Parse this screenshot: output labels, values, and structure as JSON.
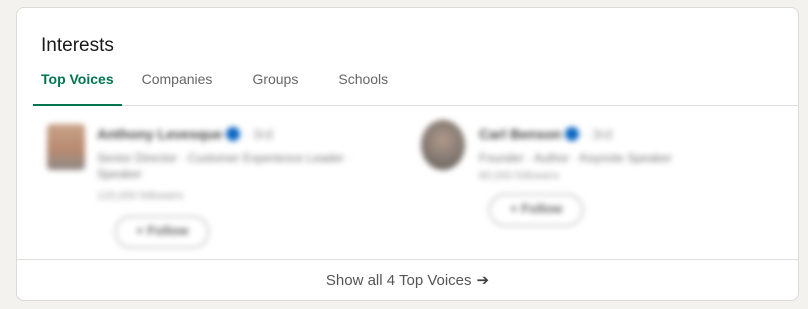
{
  "card": {
    "title": "Interests"
  },
  "tabs": [
    {
      "label": "Top Voices",
      "active": true
    },
    {
      "label": "Companies",
      "active": false
    },
    {
      "label": "Groups",
      "active": false
    },
    {
      "label": "Schools",
      "active": false
    }
  ],
  "voices": [
    {
      "name": "Anthony Levesque",
      "degree": "· 3rd",
      "headline": "Senior Director · Customer Experience Leader · Speaker",
      "followers": "120,000 followers",
      "button_label": "+ Follow"
    },
    {
      "name": "Carl Benson",
      "degree": "· 3rd",
      "headline": "Founder · Author · Keynote Speaker",
      "followers": "80,000 followers",
      "button_label": "+ Follow"
    }
  ],
  "footer": {
    "show_all_label": "Show all 4 Top Voices",
    "arrow_glyph": "➔"
  },
  "colors": {
    "accent_green": "#01754f",
    "verified_blue": "#0a66c2",
    "page_background": "#f4f2ee"
  }
}
